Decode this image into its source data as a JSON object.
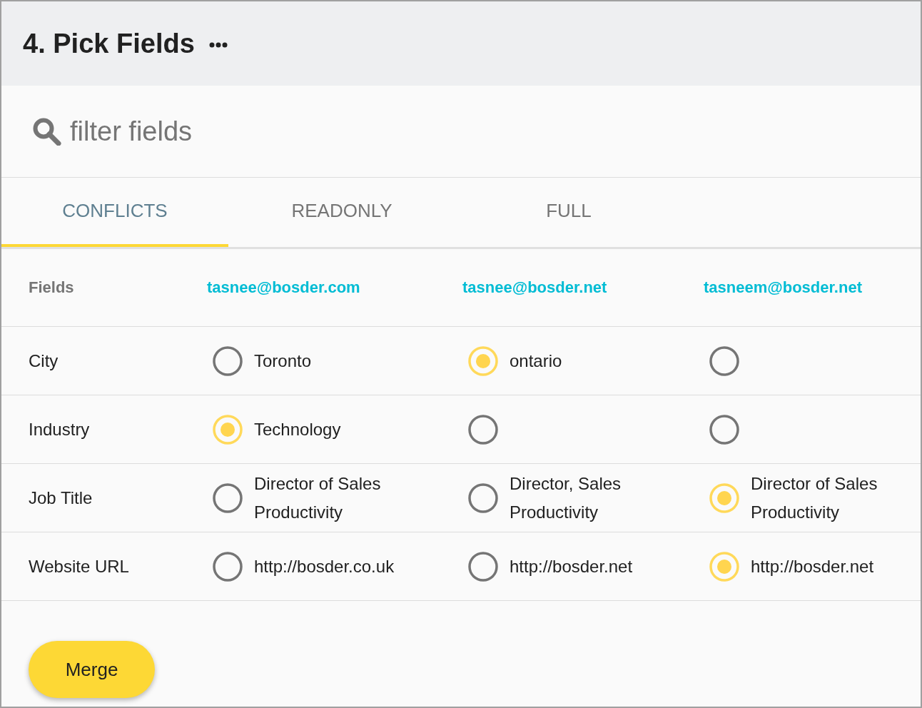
{
  "header": {
    "title": "4. Pick Fields"
  },
  "search": {
    "placeholder": "filter fields"
  },
  "tabs": [
    {
      "label": "CONFLICTS",
      "selected": true
    },
    {
      "label": "READONLY",
      "selected": false
    },
    {
      "label": "FULL",
      "selected": false
    }
  ],
  "table": {
    "columns": [
      "Fields",
      "tasnee@bosder.com",
      "tasnee@bosder.net",
      "tasneem@bosder.net"
    ],
    "rows": [
      {
        "field": "City",
        "options": [
          {
            "value": "Toronto",
            "selected": false
          },
          {
            "value": "ontario",
            "selected": true
          },
          {
            "selected": false
          }
        ]
      },
      {
        "field": "Industry",
        "options": [
          {
            "value": "Technology",
            "selected": true
          },
          {
            "selected": false
          },
          {
            "selected": false
          }
        ]
      },
      {
        "field": "Job Title",
        "options": [
          {
            "value": "Director of Sales Productivity",
            "selected": false
          },
          {
            "value": "Director, Sales Productivity",
            "selected": false
          },
          {
            "value": "Director of Sales Productivity",
            "selected": true
          }
        ]
      },
      {
        "field": "Website URL",
        "options": [
          {
            "value": "http://bosder.co.uk",
            "selected": false
          },
          {
            "value": "http://bosder.net",
            "selected": false
          },
          {
            "value": "http://bosder.net",
            "selected": true
          }
        ]
      }
    ]
  },
  "merge_button": {
    "label": "Merge"
  }
}
